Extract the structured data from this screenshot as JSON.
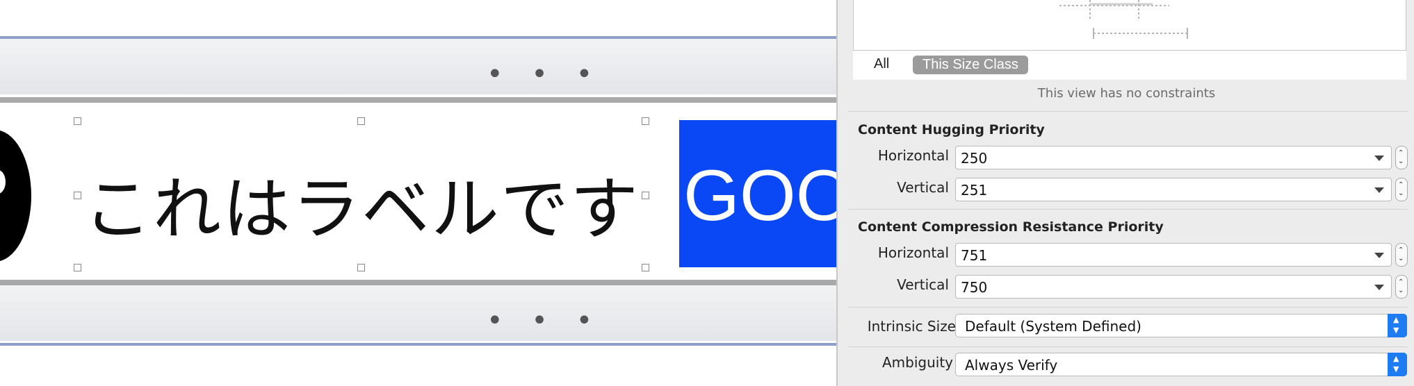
{
  "canvas": {
    "toolbar_dots": "• • •",
    "label_text": "これはラベルです",
    "button_text": "GOO",
    "button_color": "#0a48f5"
  },
  "inspector": {
    "tabs": {
      "all": "All",
      "size_class": "This Size Class"
    },
    "no_constraints": "This view has no constraints",
    "hugging": {
      "title": "Content Hugging Priority",
      "horizontal_label": "Horizontal",
      "horizontal_value": "250",
      "vertical_label": "Vertical",
      "vertical_value": "251"
    },
    "compression": {
      "title": "Content Compression Resistance Priority",
      "horizontal_label": "Horizontal",
      "horizontal_value": "751",
      "vertical_label": "Vertical",
      "vertical_value": "750"
    },
    "intrinsic": {
      "label": "Intrinsic Size",
      "value": "Default (System Defined)"
    },
    "ambiguity": {
      "label": "Ambiguity",
      "value": "Always Verify"
    },
    "accent_color": "#1f7bf2"
  }
}
